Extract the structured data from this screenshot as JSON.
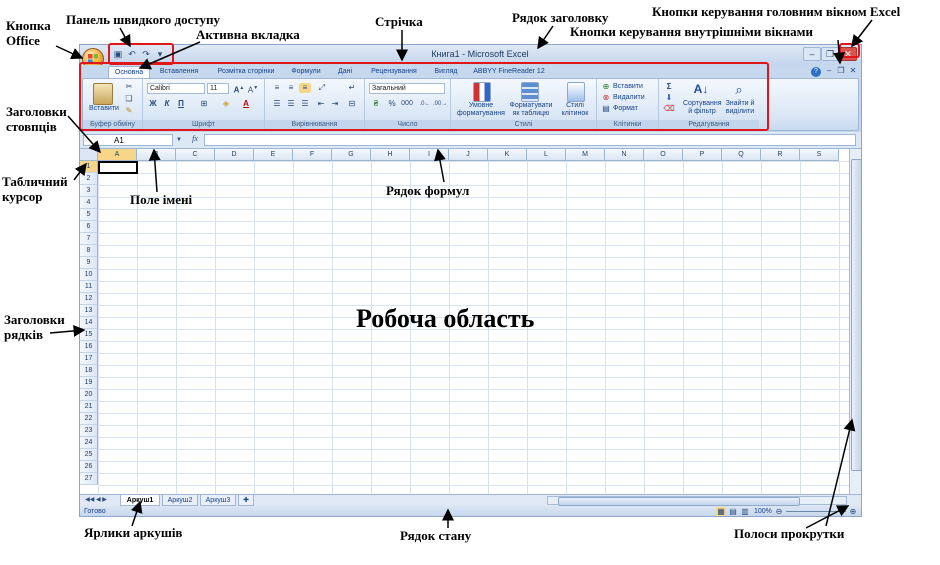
{
  "window": {
    "title": "Книга1 - Microsoft Excel",
    "controls": {
      "minimize": "–",
      "restore": "❐",
      "close": "✕",
      "inner_min": "–",
      "inner_restore": "❐",
      "inner_close": "✕"
    }
  },
  "qat": {
    "save_icon": "save-icon",
    "undo_icon": "undo-icon",
    "redo_icon": "redo-icon"
  },
  "tabs": [
    "Основна",
    "Вставлення",
    "Розмітка сторінки",
    "Формули",
    "Дані",
    "Рецензування",
    "Вигляд",
    "ABBYY FineReader 12"
  ],
  "ribbon": {
    "clipboard": {
      "paste": "Вставити",
      "label": "Буфер обміну"
    },
    "font": {
      "font_name": "Calibri",
      "font_size": "11",
      "bold": "Ж",
      "italic": "К",
      "underline": "П",
      "label": "Шрифт"
    },
    "alignment": {
      "label": "Вирівнювання"
    },
    "number": {
      "format": "Загальний",
      "percent": "%",
      "thousands": "000",
      "label": "Число"
    },
    "styles": {
      "conditional": "Умовне форматування",
      "format_table": "Форматувати як таблицю",
      "cell_styles": "Стилі клітинок",
      "label": "Стилі"
    },
    "cells": {
      "insert": "Вставити",
      "delete": "Видалити",
      "format": "Формат",
      "label": "Клітинки"
    },
    "editing": {
      "sort": "Сортування й фільтр",
      "find": "Знайти й виділити",
      "label": "Редагування"
    }
  },
  "formula_bar": {
    "name_box": "A1",
    "fx": "fx"
  },
  "columns": [
    "A",
    "B",
    "C",
    "D",
    "E",
    "F",
    "G",
    "H",
    "I",
    "J",
    "K",
    "L",
    "M",
    "N",
    "O",
    "P",
    "Q",
    "R",
    "S"
  ],
  "rows": [
    "1",
    "2",
    "3",
    "4",
    "5",
    "6",
    "7",
    "8",
    "9",
    "10",
    "11",
    "12",
    "13",
    "14",
    "15",
    "16",
    "17",
    "18",
    "19",
    "20",
    "21",
    "22",
    "23",
    "24",
    "25",
    "26",
    "27"
  ],
  "sheets": [
    "Аркуш1",
    "Аркуш2",
    "Аркуш3"
  ],
  "status": {
    "ready": "Готово",
    "zoom": "100%"
  },
  "annotations": {
    "office_button": "Кнопка Office",
    "qat": "Панель швидкого доступу",
    "active_tab": "Активна вкладка",
    "ribbon": "Стрічка",
    "title_bar": "Рядок заголовку",
    "main_window_controls": "Кнопки керування головним вікном Excel",
    "inner_window_controls": "Кнопки керування внутрішніми вікнами",
    "column_headers": "Заголовки стовпців",
    "cell_cursor": "Табличний курсор",
    "name_box": "Поле імені",
    "formula_bar": "Рядок формул",
    "work_area": "Робоча область",
    "row_headers": "Заголовки рядків",
    "sheet_tabs": "Ярлики аркушів",
    "status_bar": "Рядок стану",
    "scrollbars": "Полоси прокрутки"
  },
  "colors": {
    "accent": "#e0161b",
    "ribbon_text": "#15428b",
    "selection": "#f7d68a"
  }
}
